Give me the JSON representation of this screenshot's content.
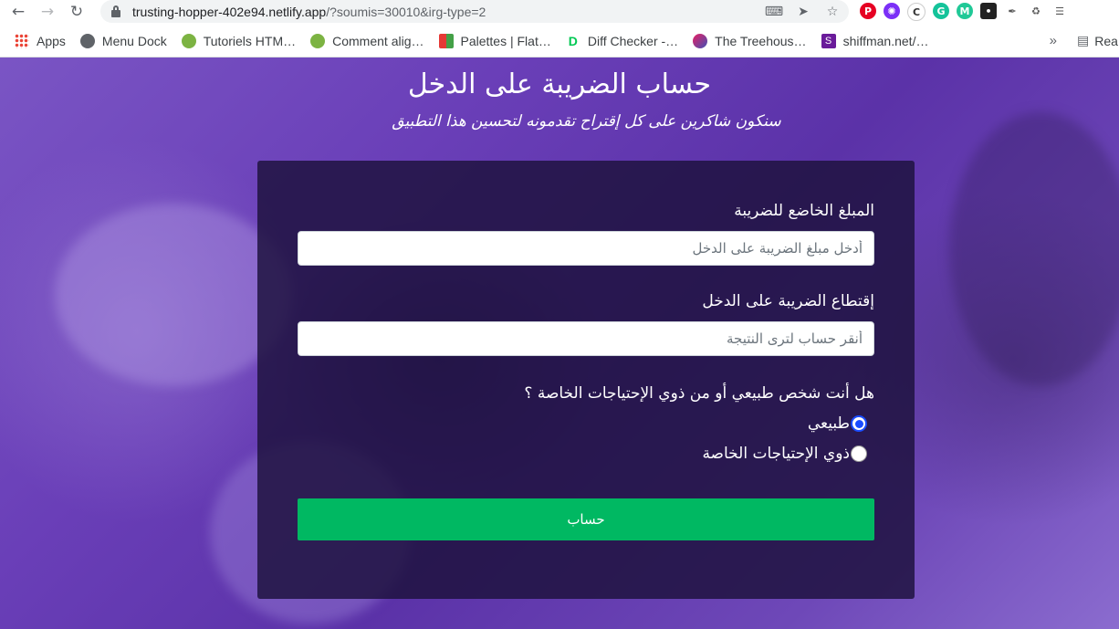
{
  "browser": {
    "url_host": "trusting-hopper-402e94.netlify.app",
    "url_rest": "/?soumis=30010&irg-type=2",
    "bookmarks": [
      {
        "label": "Apps",
        "color": "#4285f4"
      },
      {
        "label": "Menu Dock",
        "color": "#5f6368"
      },
      {
        "label": "Tutoriels HTM…",
        "color": "#7cb342"
      },
      {
        "label": "Comment alig…",
        "color": "#7cb342"
      },
      {
        "label": "Palettes | Flat…",
        "color": "#e53935"
      },
      {
        "label": "Diff Checker -…",
        "color": "#00c853"
      },
      {
        "label": "The Treehous…",
        "color": "#8e7cc3"
      },
      {
        "label": "shiffman.net/…",
        "color": "#6a1b9a"
      }
    ],
    "bookmarks_more": "»",
    "reading_list": "Rea"
  },
  "page": {
    "title": "حساب الضريبة على الدخل",
    "subtitle": "سنكون شاكرين على كل إقتراح تقدمونه لتحسين هذا التطبيق"
  },
  "form": {
    "taxable_amount": {
      "label": "المبلغ الخاضع للضريبة",
      "placeholder": "أدخل مبلغ الضريبة على الدخل"
    },
    "tax_deduction": {
      "label": "إقتطاع الضريبة على الدخل",
      "placeholder": "أنقر حساب لترى النتيجة"
    },
    "person_type": {
      "question": "هل أنت شخص طبيعي أو من ذوي الإحتياجات الخاصة ؟",
      "options": [
        {
          "label": "طبيعي",
          "checked": true
        },
        {
          "label": "ذوي الإحتياجات الخاصة",
          "checked": false
        }
      ]
    },
    "submit_label": "حساب",
    "submit_color": "#00b862"
  }
}
